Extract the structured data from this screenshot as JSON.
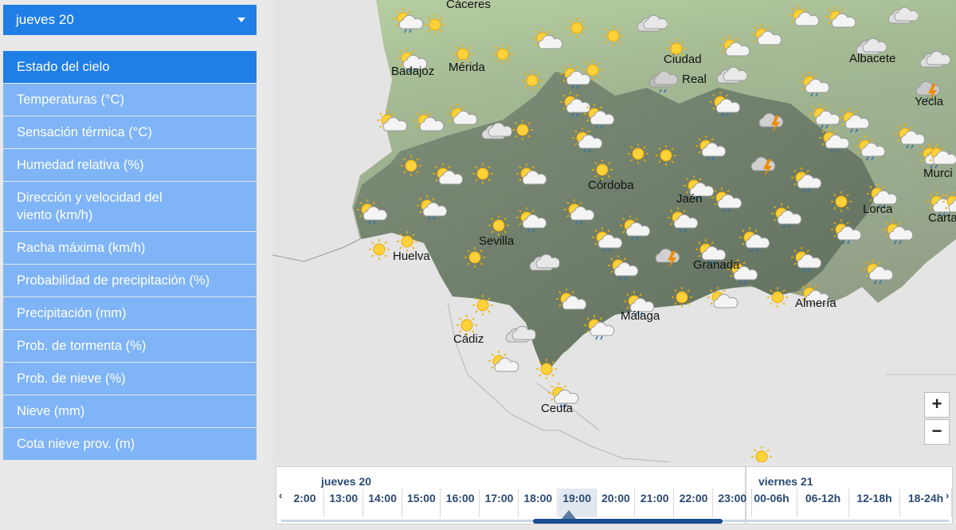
{
  "day_selector": {
    "label": "jueves 20"
  },
  "menu": {
    "items": [
      {
        "label": "Estado del cielo",
        "active": true
      },
      {
        "label": "Temperaturas (°C)"
      },
      {
        "label": "Sensación térmica (°C)"
      },
      {
        "label": "Humedad relativa (%)"
      },
      {
        "label": "Dirección y velocidad del viento (km/h)"
      },
      {
        "label": "Racha máxima (km/h)"
      },
      {
        "label": "Probabilidad de precipitación (%)"
      },
      {
        "label": "Precipitación (mm)"
      },
      {
        "label": "Prob. de tormenta (%)"
      },
      {
        "label": "Prob. de nieve (%)"
      },
      {
        "label": "Nieve (mm)"
      },
      {
        "label": "Cota nieve prov. (m)"
      }
    ]
  },
  "map": {
    "cities": [
      "Cáceres",
      "Mérida",
      "Badajoz",
      "Ciudad",
      "Real",
      "Albacete",
      "Yecla",
      "Córdoba",
      "Jaén",
      "Lorca",
      "Murci",
      "Carta",
      "Sevilla",
      "Huelva",
      "Granada",
      "Almería",
      "Málaga",
      "Cádiz",
      "Ceuta"
    ],
    "zoom_in": "+",
    "zoom_out": "−"
  },
  "timeline": {
    "days": [
      "jueves 20",
      "viernes 21"
    ],
    "prev_arrow": "‹",
    "next_arrow": "›",
    "slots_day1": [
      "2:00",
      "13:00",
      "14:00",
      "15:00",
      "16:00",
      "17:00",
      "18:00",
      "19:00",
      "20:00",
      "21:00",
      "22:00",
      "23:00"
    ],
    "slots_day2": [
      "00-06h",
      "06-12h",
      "12-18h",
      "18-24h"
    ],
    "selected": "19:00"
  },
  "colors": {
    "accent": "#1f7fe6",
    "menu_item": "#7fb4f6",
    "timeline_text": "#2b4a72"
  }
}
